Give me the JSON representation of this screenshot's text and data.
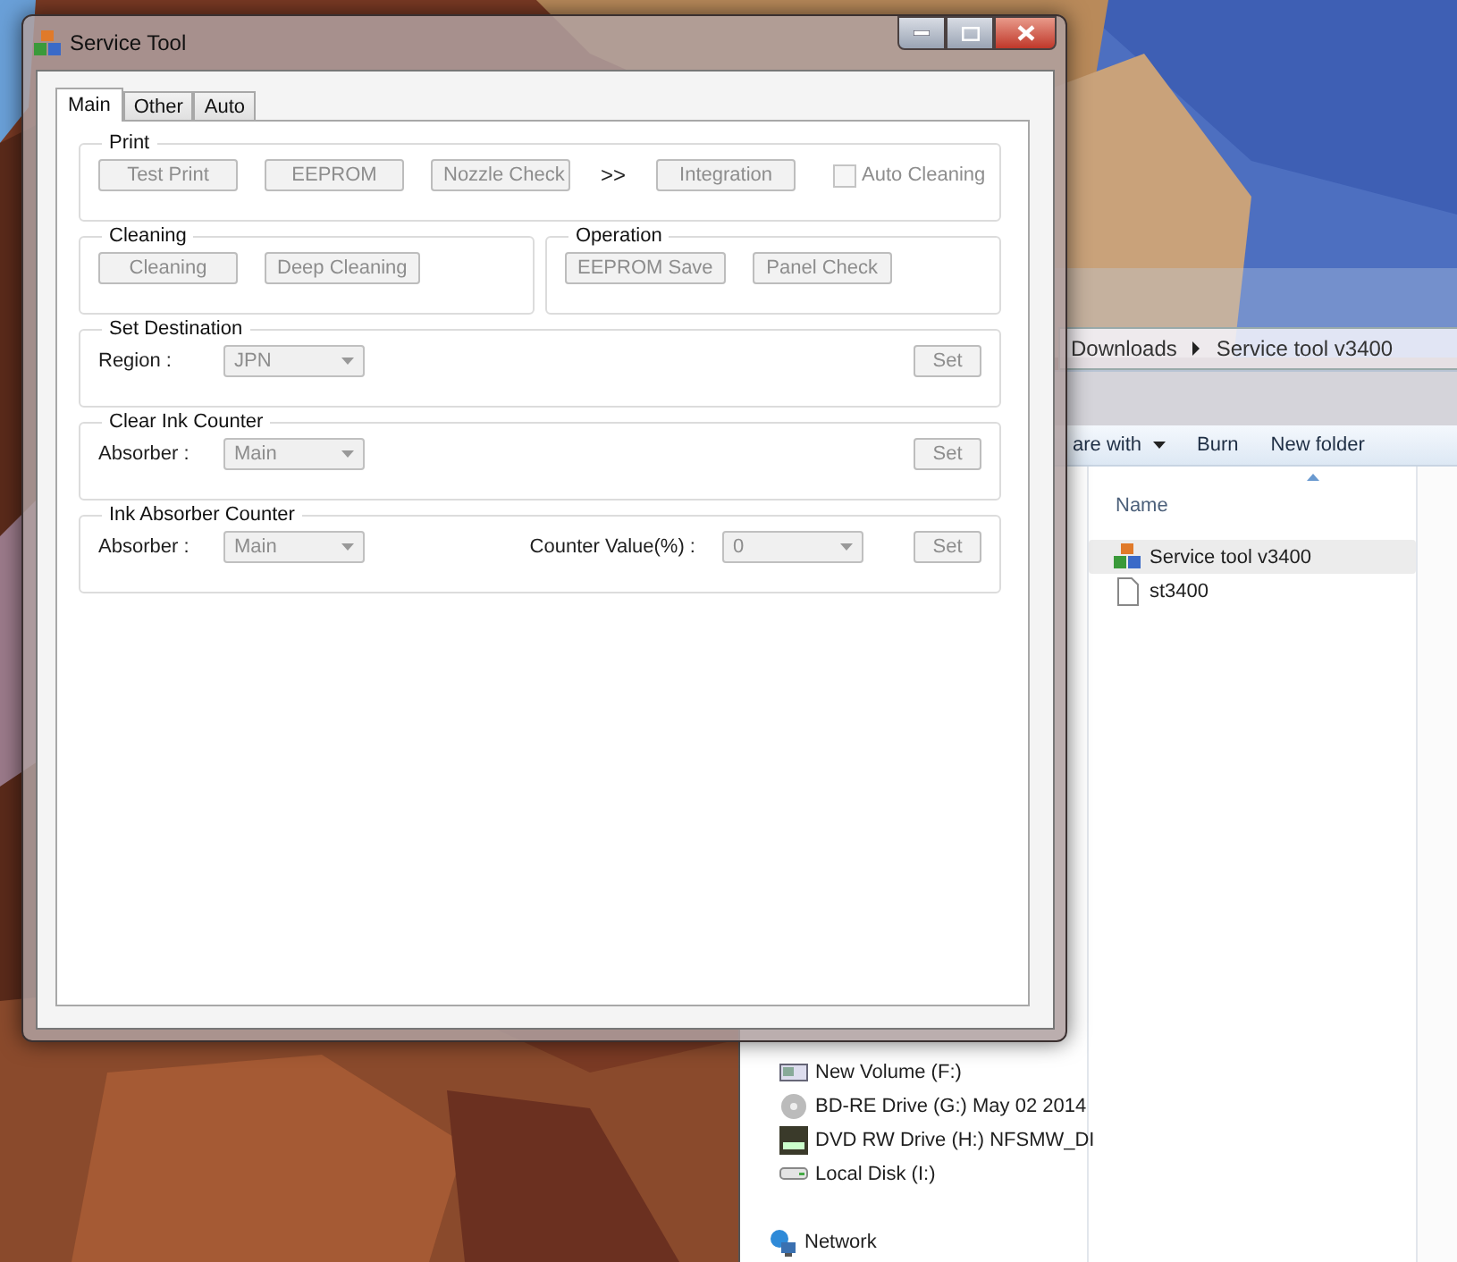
{
  "explorer": {
    "breadcrumb": [
      "Downloads",
      "Service tool v3400"
    ],
    "toolbar": [
      {
        "label": "are with",
        "dropdown": true
      },
      {
        "label": "Burn",
        "dropdown": false
      },
      {
        "label": "New folder",
        "dropdown": false
      }
    ],
    "column_header": "Name",
    "files": [
      {
        "name": "Service tool v3400",
        "kind": "app",
        "selected": true
      },
      {
        "name": "st3400",
        "kind": "file",
        "selected": false
      }
    ],
    "nav_items": [
      {
        "label": "New Volume (F:)",
        "kind": "volume"
      },
      {
        "label": "BD-RE Drive (G:) May 02 2014",
        "kind": "disc"
      },
      {
        "label": "DVD RW Drive (H:) NFSMW_DI",
        "kind": "dvd"
      },
      {
        "label": "Local Disk (I:)",
        "kind": "disk"
      },
      {
        "label": "Network",
        "kind": "network"
      }
    ]
  },
  "service_tool": {
    "title": "Service Tool",
    "tabs": [
      {
        "label": "Main",
        "selected": true
      },
      {
        "label": "Other",
        "selected": false
      },
      {
        "label": "Auto",
        "selected": false
      }
    ],
    "rows": [
      [
        {
          "title": "Print",
          "controls": [
            {
              "kind": "button",
              "label": "Test Print",
              "disabled": true
            },
            {
              "kind": "button",
              "label": "EEPROM",
              "disabled": true
            },
            {
              "kind": "button",
              "label": "Nozzle Check",
              "disabled": true
            },
            {
              "kind": "text",
              "label": ">>"
            },
            {
              "kind": "button",
              "label": "Integration",
              "disabled": true
            },
            {
              "kind": "checkbox",
              "label": "Auto Cleaning",
              "checked": false,
              "disabled": true
            }
          ]
        }
      ],
      [
        {
          "title": "Cleaning",
          "controls": [
            {
              "kind": "button",
              "label": "Cleaning",
              "disabled": true
            },
            {
              "kind": "button",
              "label": "Deep Cleaning",
              "disabled": true
            }
          ]
        },
        {
          "title": "Operation",
          "controls": [
            {
              "kind": "button",
              "label": "EEPROM Save",
              "disabled": true
            },
            {
              "kind": "button",
              "label": "Panel Check",
              "disabled": true
            }
          ]
        }
      ],
      [
        {
          "title": "Set Destination",
          "controls": [
            {
              "kind": "label",
              "label": "Region :"
            },
            {
              "kind": "select",
              "value": "JPN",
              "disabled": true
            },
            {
              "kind": "button",
              "label": "Set",
              "disabled": true
            }
          ]
        }
      ],
      [
        {
          "title": "Clear Ink Counter",
          "controls": [
            {
              "kind": "label",
              "label": "Absorber :"
            },
            {
              "kind": "select",
              "value": "Main",
              "disabled": true
            },
            {
              "kind": "button",
              "label": "Set",
              "disabled": true
            }
          ]
        }
      ],
      [
        {
          "title": "Ink Absorber Counter",
          "controls": [
            {
              "kind": "label",
              "label": "Absorber :"
            },
            {
              "kind": "select",
              "value": "Main",
              "disabled": true
            },
            {
              "kind": "label",
              "label": "Counter Value(%) :"
            },
            {
              "kind": "select",
              "value": "0",
              "disabled": true
            },
            {
              "kind": "button",
              "label": "Set",
              "disabled": true
            }
          ]
        }
      ]
    ]
  }
}
